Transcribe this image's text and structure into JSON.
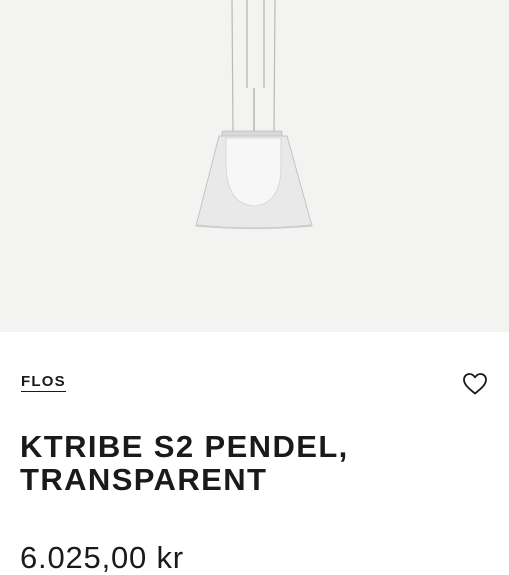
{
  "product": {
    "image_icon": "pendant-lamp-image",
    "brand": "FLOS",
    "title_line1": "KTRIBE S2 PENDEL,",
    "title_line2": "TRANSPARENT",
    "price": "6.025,00 kr",
    "wishlist_icon": "heart-icon"
  },
  "colors": {
    "image_background": "#f3f3f2",
    "text": "#1a1a1a"
  }
}
